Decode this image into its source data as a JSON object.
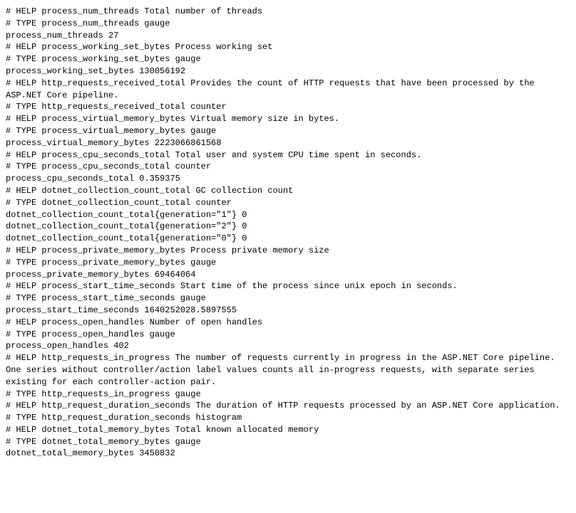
{
  "lines": [
    "# HELP process_num_threads Total number of threads",
    "# TYPE process_num_threads gauge",
    "process_num_threads 27",
    "# HELP process_working_set_bytes Process working set",
    "# TYPE process_working_set_bytes gauge",
    "process_working_set_bytes 130056192",
    "# HELP http_requests_received_total Provides the count of HTTP requests that have been processed by the ASP.NET Core pipeline.",
    "# TYPE http_requests_received_total counter",
    "# HELP process_virtual_memory_bytes Virtual memory size in bytes.",
    "# TYPE process_virtual_memory_bytes gauge",
    "process_virtual_memory_bytes 2223066861568",
    "# HELP process_cpu_seconds_total Total user and system CPU time spent in seconds.",
    "# TYPE process_cpu_seconds_total counter",
    "process_cpu_seconds_total 0.359375",
    "# HELP dotnet_collection_count_total GC collection count",
    "# TYPE dotnet_collection_count_total counter",
    "dotnet_collection_count_total{generation=\"1\"} 0",
    "dotnet_collection_count_total{generation=\"2\"} 0",
    "dotnet_collection_count_total{generation=\"0\"} 0",
    "# HELP process_private_memory_bytes Process private memory size",
    "# TYPE process_private_memory_bytes gauge",
    "process_private_memory_bytes 69464064",
    "# HELP process_start_time_seconds Start time of the process since unix epoch in seconds.",
    "# TYPE process_start_time_seconds gauge",
    "process_start_time_seconds 1640252028.5897555",
    "# HELP process_open_handles Number of open handles",
    "# TYPE process_open_handles gauge",
    "process_open_handles 402",
    "# HELP http_requests_in_progress The number of requests currently in progress in the ASP.NET Core pipeline. One series without controller/action label values counts all in-progress requests, with separate series existing for each controller-action pair.",
    "# TYPE http_requests_in_progress gauge",
    "# HELP http_request_duration_seconds The duration of HTTP requests processed by an ASP.NET Core application.",
    "# TYPE http_request_duration_seconds histogram",
    "# HELP dotnet_total_memory_bytes Total known allocated memory",
    "# TYPE dotnet_total_memory_bytes gauge",
    "dotnet_total_memory_bytes 3450832"
  ]
}
